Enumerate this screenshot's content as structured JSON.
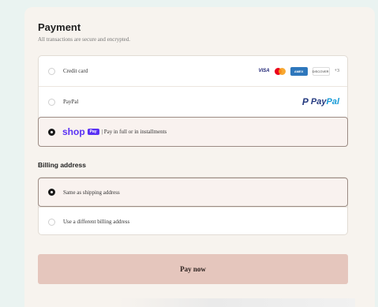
{
  "payment": {
    "title": "Payment",
    "subtitle": "All transactions are secure and encrypted.",
    "methods": [
      {
        "label": "Credit card",
        "selected": false
      },
      {
        "label": "PayPal",
        "selected": false
      },
      {
        "label": "| Pay in full or in installments",
        "selected": true
      }
    ],
    "card_brands": {
      "visa": "VISA",
      "amex": "AMEX",
      "discover": "DISCOVER",
      "more": "+3"
    },
    "paypal_logo": {
      "first": "Pay",
      "second": "Pal"
    },
    "shop_pay": {
      "word": "shop",
      "badge": "Pay"
    }
  },
  "billing": {
    "title": "Billing address",
    "options": [
      {
        "label": "Same as shipping address",
        "selected": true
      },
      {
        "label": "Use a different billing address",
        "selected": false
      }
    ]
  },
  "pay_button_label": "Pay now",
  "colors": {
    "accent": "#5a31f4",
    "button": "#e5c6bd",
    "paypal_dark": "#253b80",
    "paypal_light": "#179bd7"
  }
}
